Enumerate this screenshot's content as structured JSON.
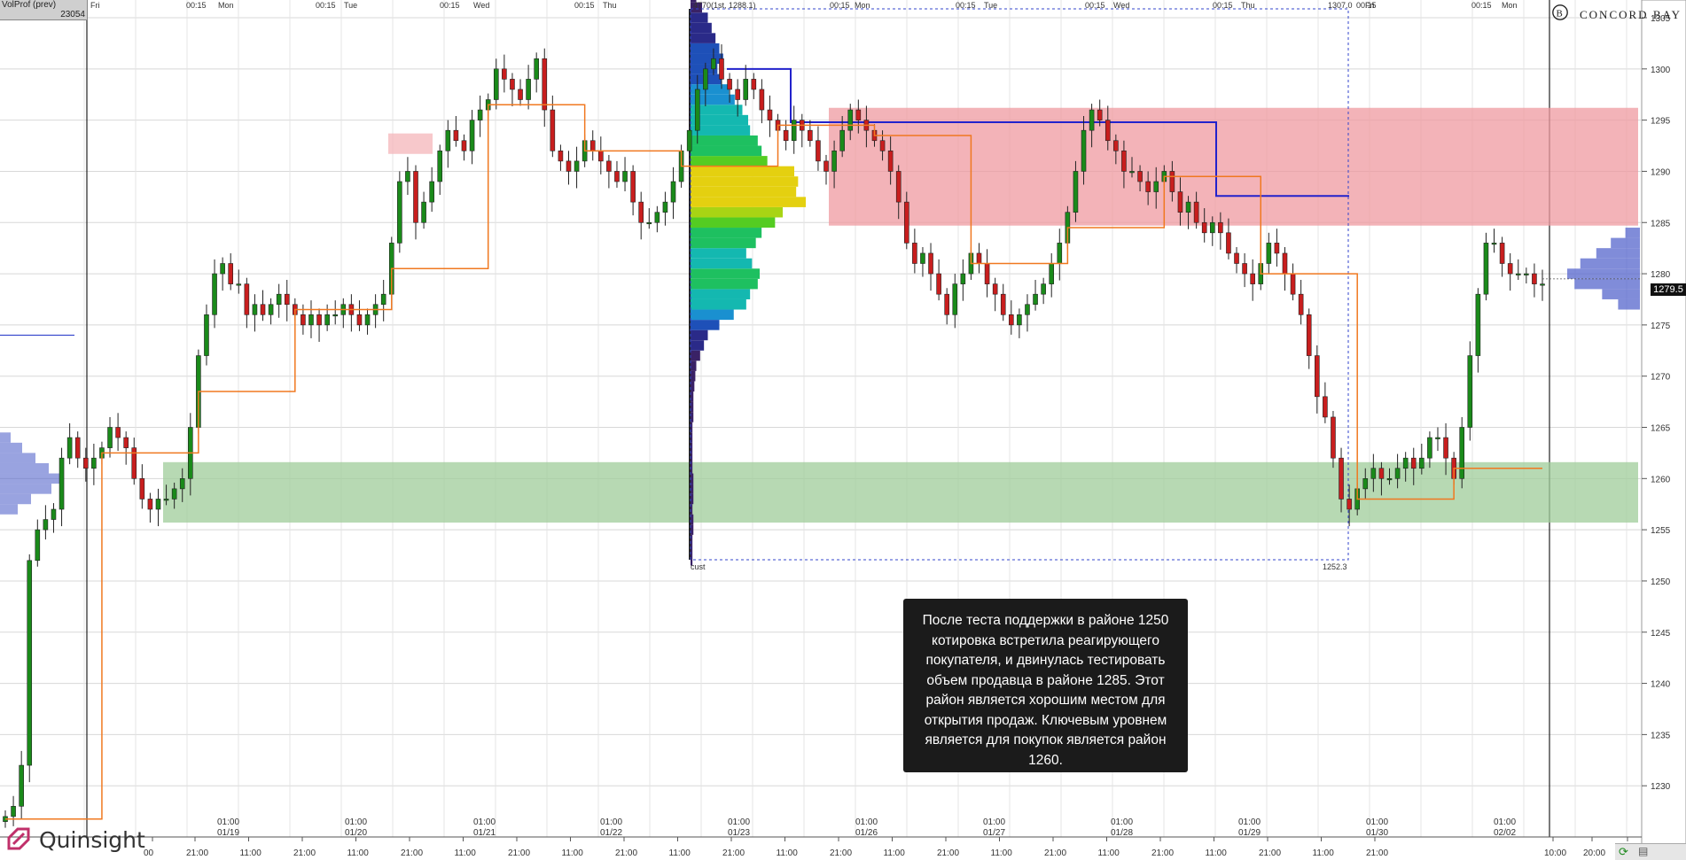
{
  "indicator": {
    "name": "VolProf (prev)",
    "value": "23054"
  },
  "brand": {
    "right_logo": "CONCORD BAY",
    "left_logo": "Quinsight",
    "right_logo_icon": "concord-bay-logo-icon",
    "left_logo_icon": "quinsight-logo-icon"
  },
  "top_day_labels": [
    {
      "text": "Fri",
      "type": "day"
    },
    {
      "text": "00:15",
      "type": "time"
    },
    {
      "text": "Mon",
      "type": "day"
    },
    {
      "text": "00:15",
      "type": "time"
    },
    {
      "text": "Tue",
      "type": "day"
    },
    {
      "text": "00:15",
      "type": "time"
    },
    {
      "text": "Wed",
      "type": "day"
    },
    {
      "text": "00:15",
      "type": "time"
    },
    {
      "text": "Thu",
      "type": "day"
    },
    {
      "text": "4770(1st, 1288.1)",
      "type": "info"
    },
    {
      "text": "00:15",
      "type": "time"
    },
    {
      "text": "Mon",
      "type": "day"
    },
    {
      "text": "00:15",
      "type": "time"
    },
    {
      "text": "Tue",
      "type": "day"
    },
    {
      "text": "00:15",
      "type": "time"
    },
    {
      "text": "Wed",
      "type": "day"
    },
    {
      "text": "00:15",
      "type": "time"
    },
    {
      "text": "Thu",
      "type": "day"
    },
    {
      "text": "1307.0",
      "type": "info"
    },
    {
      "text": "00:15",
      "type": "time"
    },
    {
      "text": "Fri",
      "type": "day"
    },
    {
      "text": "00:15",
      "type": "time"
    },
    {
      "text": "Mon",
      "type": "day"
    }
  ],
  "date_labels": [
    {
      "time": "01:00",
      "date": "01/19"
    },
    {
      "time": "01:00",
      "date": "01/20"
    },
    {
      "time": "01:00",
      "date": "01/21"
    },
    {
      "time": "01:00",
      "date": "01/22"
    },
    {
      "time": "01:00",
      "date": "01/23"
    },
    {
      "time": "01:00",
      "date": "01/26"
    },
    {
      "time": "01:00",
      "date": "01/27"
    },
    {
      "time": "01:00",
      "date": "01/28"
    },
    {
      "time": "01:00",
      "date": "01/29"
    },
    {
      "time": "01:00",
      "date": "01/30"
    },
    {
      "time": "01:00",
      "date": "02/02"
    }
  ],
  "bottom_time_labels": [
    "00",
    "21:00",
    "11:00",
    "21:00",
    "11:00",
    "21:00",
    "11:00",
    "21:00",
    "11:00",
    "21:00",
    "11:00",
    "21:00",
    "11:00",
    "21:00",
    "11:00",
    "21:00",
    "11:00",
    "21:00",
    "11:00",
    "21:00",
    "11:00",
    "21:00",
    "11:00",
    "21:00",
    "10:00",
    "20:00",
    "01:00"
  ],
  "profile_labels": {
    "bottom_left": "cust",
    "low_label": "1252.3"
  },
  "current_price_label": "1279.5",
  "annotation_text": "После теста поддержки в районе 1250 котировка встретила реагирующего покупателя, и двинулась тестировать объем продавца в районе 1285. Этот район является хорошим местом для открытия продаж. Ключевым уровнем является для покупок является район 1260.",
  "colors": {
    "up_candle": "#1a8a1a",
    "down_candle": "#c81e1e",
    "step_line": "#f07820",
    "resistance_zone": "#ef9aa0",
    "support_zone": "#9fcc9a",
    "poc_line": "#2222cc",
    "profile_box": "#3344cc",
    "grid": "#d8d8d8"
  },
  "chart_data": {
    "type": "candlestick",
    "y_axis": {
      "min": 1225,
      "max": 1305,
      "ticks": [
        1230,
        1235,
        1240,
        1245,
        1250,
        1255,
        1260,
        1265,
        1270,
        1275,
        1280,
        1285,
        1290,
        1295,
        1300,
        1305
      ]
    },
    "zones": [
      {
        "name": "resistance",
        "low": 1284.7,
        "high": 1296.2,
        "x_start_bar": 0.47,
        "x_end_bar": 1.0
      },
      {
        "name": "support",
        "low": 1255.7,
        "high": 1261.6,
        "x_start_bar": 0.09,
        "x_end_bar": 1.0
      },
      {
        "name": "old-resistance",
        "low": 1291.7,
        "high": 1293.7,
        "x_start_bar": 0.22,
        "x_end_bar": 0.265
      }
    ],
    "poc_levels": [
      1294.8,
      1287.6
    ],
    "current_price": 1279.5,
    "profile_low": 1252.3,
    "close_path": [
      1227,
      1228,
      1232,
      1252,
      1255,
      1256,
      1257,
      1262,
      1264,
      1262,
      1261,
      1262,
      1263,
      1265,
      1264,
      1263,
      1260,
      1258,
      1257,
      1258,
      1258,
      1259,
      1260,
      1265,
      1272,
      1276,
      1280,
      1281,
      1279,
      1279,
      1276,
      1277,
      1276,
      1277,
      1278,
      1277,
      1276,
      1275,
      1276,
      1275,
      1276,
      1276,
      1277,
      1276,
      1275,
      1276,
      1277,
      1278,
      1283,
      1289,
      1290,
      1285,
      1287,
      1289,
      1292,
      1294,
      1293,
      1292,
      1295,
      1296,
      1297,
      1300,
      1299,
      1298,
      1297,
      1299,
      1301,
      1296,
      1292,
      1291,
      1290,
      1291,
      1293,
      1292,
      1291,
      1290,
      1289,
      1290,
      1287,
      1285,
      1285,
      1286,
      1287,
      1289,
      1292,
      1294,
      1298,
      1300,
      1301,
      1299,
      1298,
      1297,
      1299,
      1298,
      1296,
      1295,
      1294,
      1293,
      1295,
      1294,
      1293,
      1291,
      1290,
      1292,
      1294,
      1296,
      1295,
      1294,
      1293,
      1292,
      1290,
      1287,
      1283,
      1281,
      1282,
      1280,
      1278,
      1276,
      1279,
      1280,
      1282,
      1281,
      1279,
      1278,
      1276,
      1275,
      1276,
      1277,
      1278,
      1279,
      1281,
      1283,
      1286,
      1290,
      1294,
      1296,
      1295,
      1293,
      1292,
      1290,
      1290,
      1289,
      1288,
      1289,
      1290,
      1288,
      1286,
      1287,
      1285,
      1284,
      1285,
      1284,
      1282,
      1281,
      1280,
      1279,
      1281,
      1283,
      1282,
      1280,
      1278,
      1276,
      1272,
      1268,
      1266,
      1262,
      1258,
      1257,
      1259,
      1260,
      1261,
      1260,
      1260,
      1261,
      1262,
      1261,
      1262,
      1264,
      1264,
      1262,
      1260,
      1265,
      1272,
      1278,
      1283,
      1283,
      1281,
      1280,
      1280,
      1280,
      1279,
      1279
    ],
    "volume_profile_levels": [
      1252,
      1253,
      1254,
      1255,
      1256,
      1257,
      1258,
      1259,
      1260,
      1261,
      1262,
      1263,
      1264,
      1265,
      1266,
      1267,
      1268,
      1269,
      1270,
      1271,
      1272,
      1273,
      1274,
      1275,
      1276,
      1277,
      1278,
      1279,
      1280,
      1281,
      1282,
      1283,
      1284,
      1285,
      1286,
      1287,
      1288,
      1289,
      1290,
      1291,
      1292,
      1293,
      1294,
      1295,
      1296,
      1297,
      1298,
      1299,
      1300,
      1301,
      1302,
      1303,
      1304,
      1305,
      1306,
      1307
    ],
    "volume_profile_values": [
      2,
      2,
      2,
      3,
      3,
      2,
      3,
      3,
      3,
      2,
      2,
      2,
      2,
      2,
      3,
      3,
      3,
      4,
      5,
      6,
      10,
      14,
      18,
      30,
      45,
      58,
      62,
      70,
      72,
      64,
      58,
      68,
      74,
      88,
      96,
      120,
      110,
      112,
      108,
      80,
      74,
      70,
      62,
      60,
      54,
      46,
      40,
      32,
      28,
      34,
      30,
      26,
      22,
      18,
      12,
      6
    ],
    "right_profile_levels": [
      1277,
      1278,
      1279,
      1280,
      1281,
      1282,
      1283,
      1284
    ],
    "right_profile_values": [
      30,
      52,
      90,
      100,
      82,
      60,
      40,
      20
    ]
  }
}
